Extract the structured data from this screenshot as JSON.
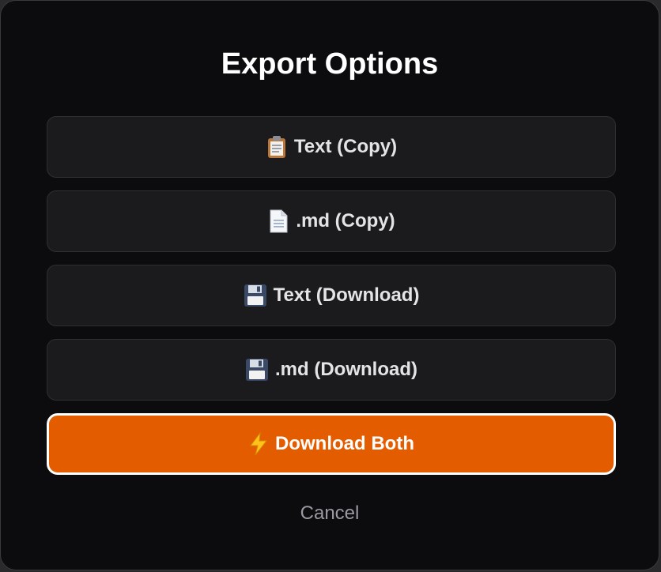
{
  "dialog": {
    "title": "Export Options",
    "options": [
      {
        "label": "Text (Copy)",
        "icon": "clipboard-icon"
      },
      {
        "label": ".md (Copy)",
        "icon": "document-icon"
      },
      {
        "label": "Text (Download)",
        "icon": "floppy-disk-icon"
      },
      {
        "label": ".md (Download)",
        "icon": "floppy-disk-icon"
      }
    ],
    "primary": {
      "label": "Download Both",
      "icon": "lightning-icon"
    },
    "cancel_label": "Cancel"
  },
  "colors": {
    "background": "#0c0c0e",
    "option_bg": "#1b1b1e",
    "accent": "#e45c00",
    "text": "#e4e4e7",
    "muted": "#9a9aa0"
  }
}
